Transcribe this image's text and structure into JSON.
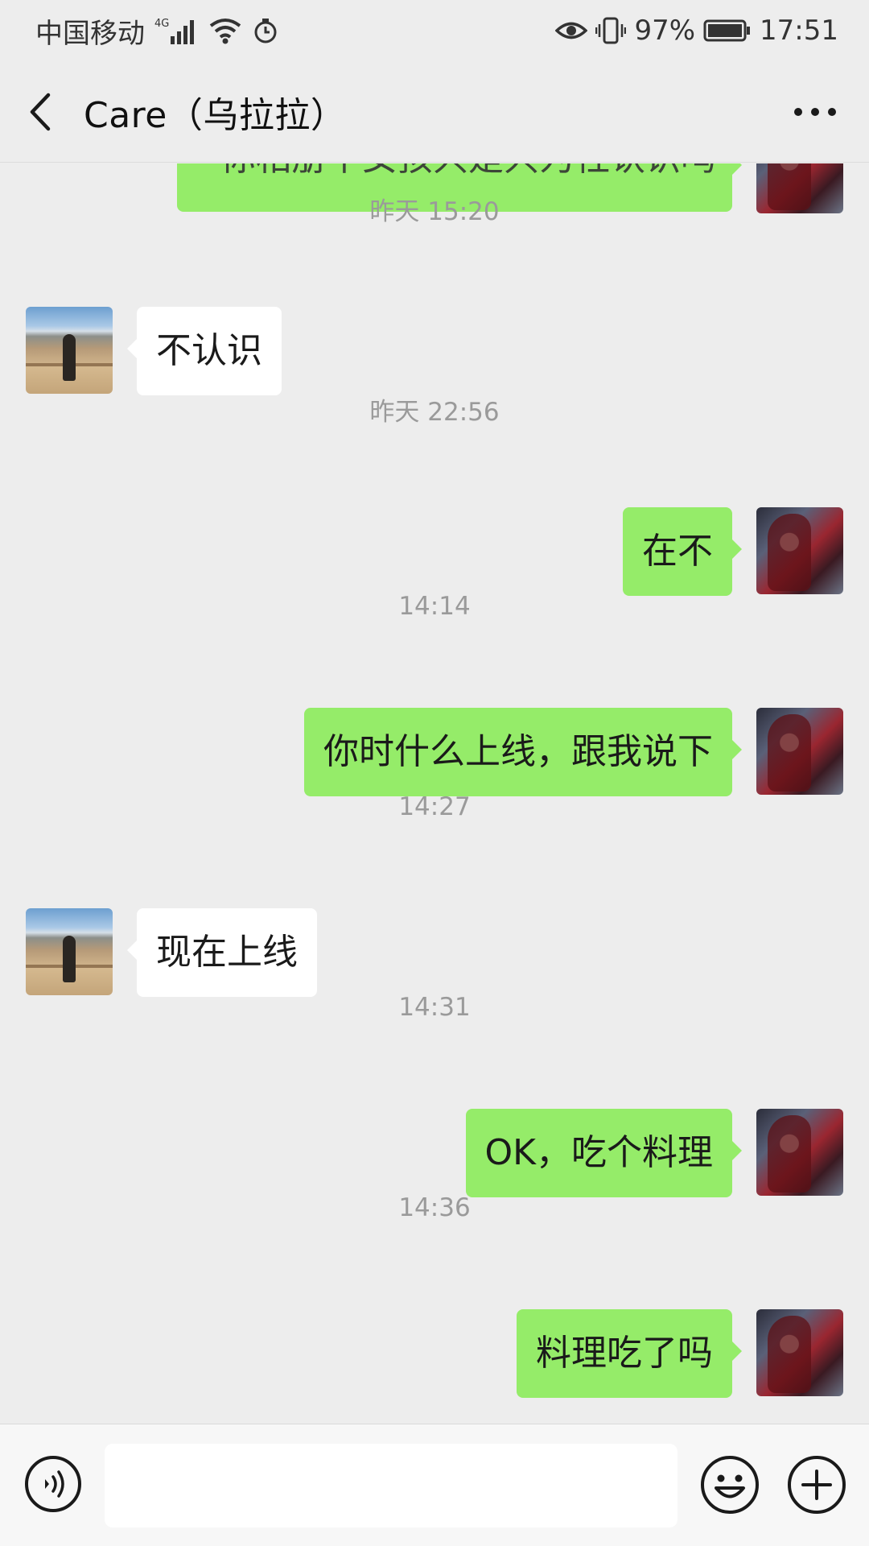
{
  "status_bar": {
    "carrier": "中国移动",
    "network": "4G",
    "battery": "97%",
    "time": "17:51"
  },
  "header": {
    "title": "Care（乌拉拉）"
  },
  "messages": {
    "cutoff_partial": "你相册中女孩只是只为社认识吗",
    "t1": "昨天 15:20",
    "m1": "不认识",
    "t2": "昨天 22:56",
    "m2": "在不",
    "t3": "14:14",
    "m3": "你时什么上线，跟我说下",
    "t4": "14:27",
    "m4": "现在上线",
    "t5": "14:31",
    "m5": "OK，吃个料理",
    "t6": "14:36",
    "m6": "料理吃了吗"
  },
  "input_bar": {
    "value": ""
  },
  "icons": {
    "back": "chevron-left-icon",
    "more": "more-icon",
    "voice": "voice-icon",
    "emoji": "emoji-icon",
    "plus": "plus-icon"
  },
  "colors": {
    "sent_bubble": "#95ec69",
    "received_bubble": "#ffffff",
    "background": "#ededed"
  }
}
